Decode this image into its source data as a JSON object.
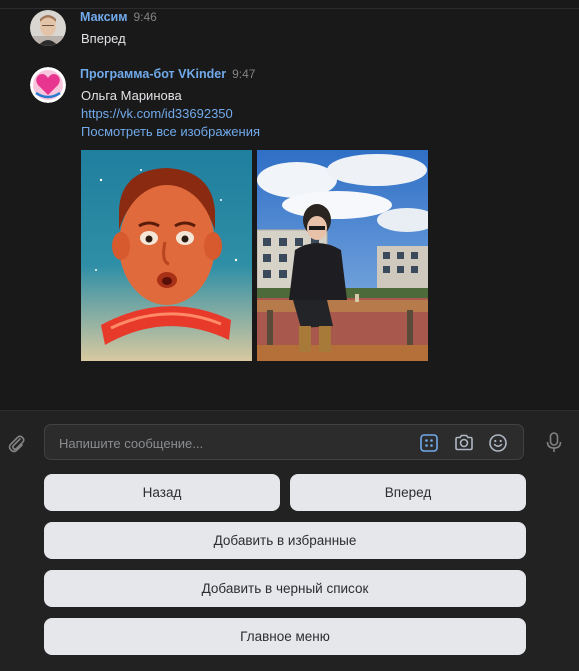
{
  "messages": [
    {
      "author": "Максим",
      "time": "9:46",
      "lines": [
        "Вперед"
      ]
    },
    {
      "author": "Программа-бот VKinder",
      "time": "9:47",
      "name": "Ольга Маринова",
      "profile_link": "https://vk.com/id33692350",
      "view_all_link": "Посмотреть все изображения",
      "photos": [
        "poster-boy-portrait",
        "woman-on-bench-photo"
      ]
    }
  ],
  "composer": {
    "placeholder": "Напишите сообщение..."
  },
  "keyboard": {
    "back": "Назад",
    "forward": "Вперед",
    "add_favorites": "Добавить в избранные",
    "add_blacklist": "Добавить в черный список",
    "main_menu": "Главное меню"
  },
  "colors": {
    "background": "#19191a",
    "link": "#71aaeb",
    "keyboard_button": "#e6e7ea",
    "accent_icon": "#71aaeb"
  }
}
